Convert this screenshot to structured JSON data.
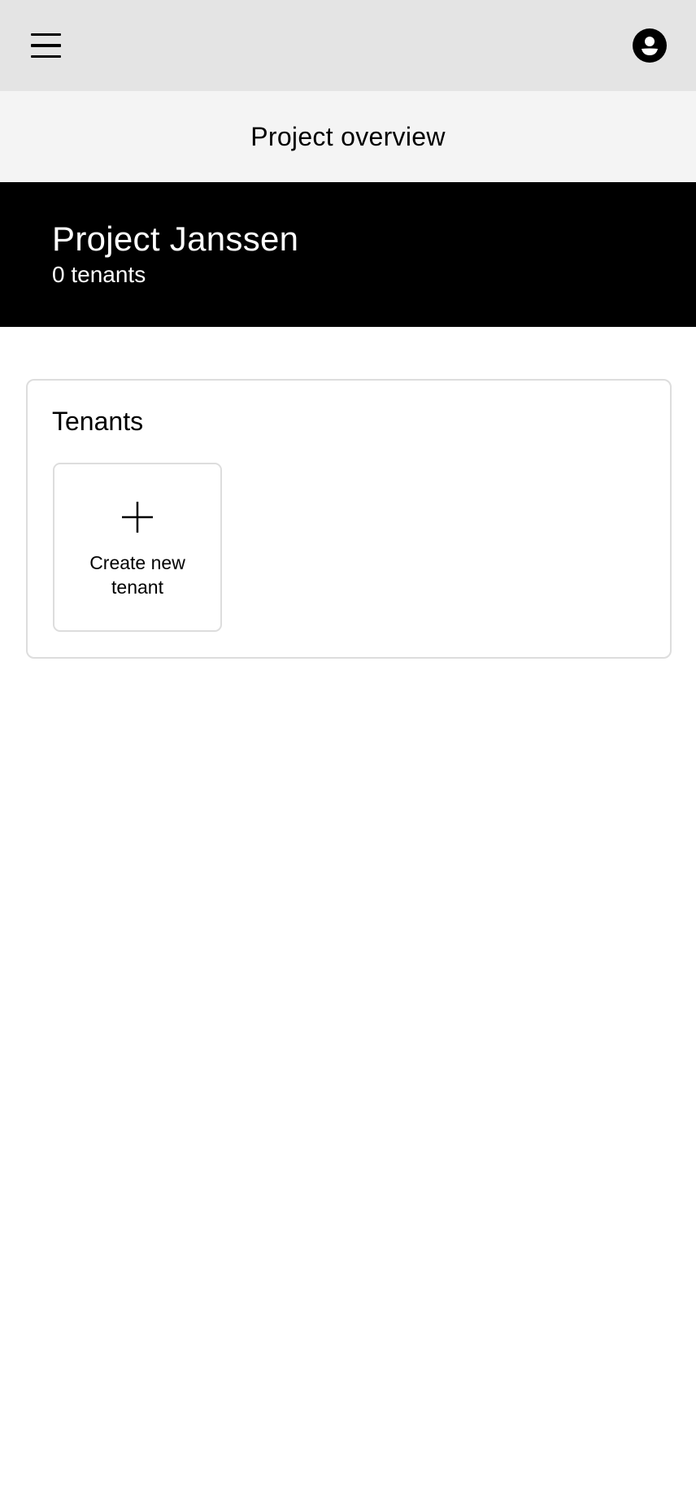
{
  "header": {
    "menu_icon": "hamburger-menu-icon",
    "avatar_icon": "user-avatar-icon"
  },
  "title_bar": {
    "title": "Project overview"
  },
  "project": {
    "name": "Project Janssen",
    "tenant_count": "0 tenants"
  },
  "tenants_section": {
    "title": "Tenants",
    "create_tile": {
      "icon": "plus-icon",
      "label_line1": "Create new",
      "label_line2": "tenant"
    }
  },
  "colors": {
    "topbar_bg": "#e4e4e4",
    "titlebar_bg": "#f4f4f4",
    "hero_bg": "#000000",
    "hero_text": "#ffffff",
    "border": "#dddddd"
  }
}
